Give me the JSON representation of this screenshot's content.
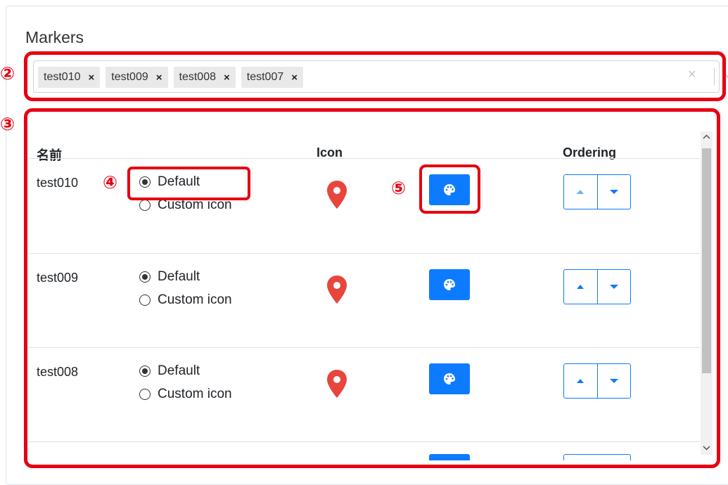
{
  "section_title": "Markers",
  "selector": {
    "chips": [
      {
        "label": "test010",
        "remove": "×"
      },
      {
        "label": "test009",
        "remove": "×"
      },
      {
        "label": "test008",
        "remove": "×"
      },
      {
        "label": "test007",
        "remove": "×"
      }
    ],
    "clear": "×"
  },
  "annotations": {
    "two": "②",
    "three": "③",
    "four": "④",
    "five": "⑤"
  },
  "table": {
    "headers": {
      "name": "名前",
      "icon": "Icon",
      "ordering": "Ordering"
    },
    "rows": [
      {
        "name": "test010",
        "opt_default": "Default",
        "opt_custom": "Custom icon",
        "selected": "Default"
      },
      {
        "name": "test009",
        "opt_default": "Default",
        "opt_custom": "Custom icon",
        "selected": "Default"
      },
      {
        "name": "test008",
        "opt_default": "Default",
        "opt_custom": "Custom icon",
        "selected": "Default"
      }
    ]
  },
  "icons": {
    "marker": "map-pin-icon",
    "color": "palette-icon",
    "up": "caret-up-icon",
    "down": "caret-down-icon"
  },
  "colors": {
    "accent": "#0d7bff",
    "marker": "#e8453c",
    "annotation": "#e60012"
  }
}
